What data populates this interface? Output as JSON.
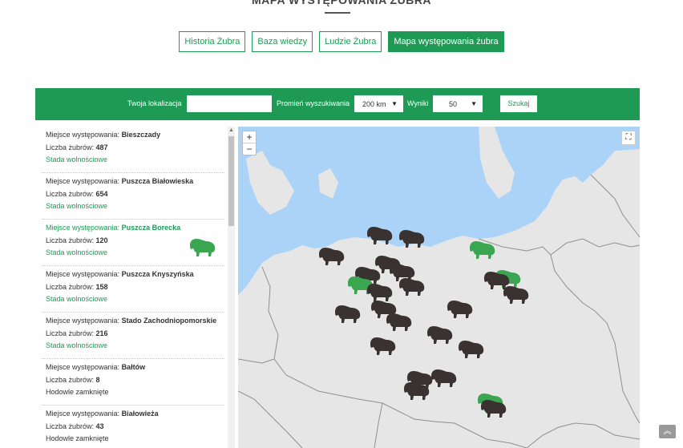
{
  "page": {
    "title": "MAPA WYSTĘPOWANIA ŻUBRA"
  },
  "nav": [
    {
      "label": "Historia Żubra",
      "active": false
    },
    {
      "label": "Baza wiedzy",
      "active": false
    },
    {
      "label": "Ludzie Żubra",
      "active": false
    },
    {
      "label": "Mapa występowania żubra",
      "active": true
    }
  ],
  "search": {
    "location_label": "Twoja lokalizacja",
    "location_value": "",
    "radius_label": "Promień wyszukiwania",
    "radius_value": "200 km",
    "results_label": "Wyniki",
    "results_value": "50",
    "submit_label": "Szukaj"
  },
  "list": {
    "location_prefix": "Miejsce występowania:",
    "count_prefix": "Liczba żubrów:",
    "items": [
      {
        "location": "Bieszczady",
        "count": "487",
        "type": "Stada wolnościowe",
        "selected": false
      },
      {
        "location": "Puszcza Białowieska",
        "count": "654",
        "type": "Stada wolnościowe",
        "selected": false
      },
      {
        "location": "Puszcza Borecka",
        "count": "120",
        "type": "Stada wolnościowe",
        "selected": true
      },
      {
        "location": "Puszcza Knyszyńska",
        "count": "158",
        "type": "Stada wolnościowe",
        "selected": false
      },
      {
        "location": "Stado Zachodniopomorskie",
        "count": "216",
        "type": "Stada wolnościowe",
        "selected": false
      },
      {
        "location": "Bałtów",
        "count": "8",
        "type": "Hodowle zamknięte",
        "selected": false
      },
      {
        "location": "Białowieża",
        "count": "43",
        "type": "Hodowle zamknięte",
        "selected": false
      }
    ]
  },
  "map": {
    "zoom_in": "+",
    "zoom_out": "−",
    "fullscreen_icon": "⛶",
    "colors": {
      "water": "#aad3f7",
      "land": "#e6e6e6",
      "border": "#8f8f8f",
      "bison_dark": "#3a3131",
      "bison_green": "#3aa64f"
    }
  },
  "ui": {
    "scroll_top_icon": "︽",
    "accent": "#1e9a55"
  }
}
